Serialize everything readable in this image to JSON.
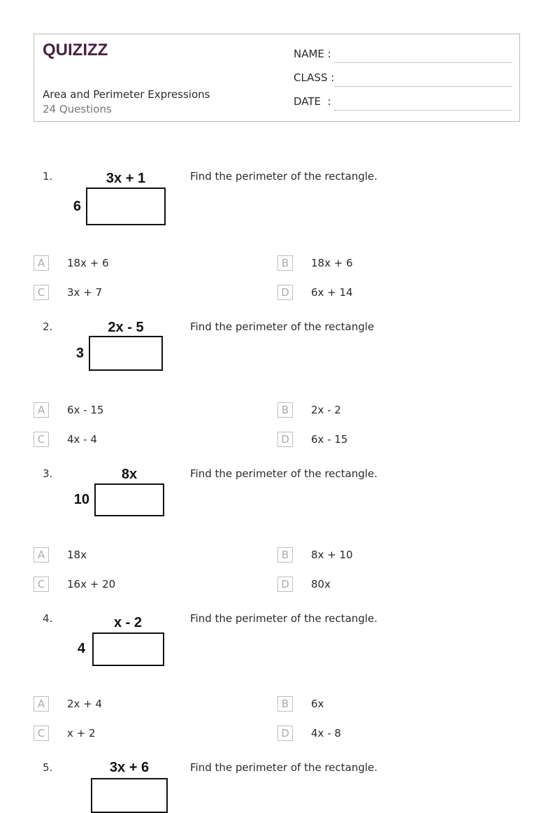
{
  "header": {
    "logo": "QUIZIZZ",
    "title": "Area and Perimeter Expressions",
    "count": "24 Questions",
    "fields": [
      {
        "label": "NAME :"
      },
      {
        "label": "CLASS :"
      },
      {
        "label": "DATE  :"
      }
    ]
  },
  "questions": [
    {
      "number": "1.",
      "text": "Find the perimeter of the rectangle.",
      "figure": {
        "top": "3x + 1",
        "side": "6"
      },
      "options": [
        {
          "letter": "A",
          "text": "18x + 6"
        },
        {
          "letter": "B",
          "text": "18x + 6"
        },
        {
          "letter": "C",
          "text": "3x + 7"
        },
        {
          "letter": "D",
          "text": "6x + 14"
        }
      ]
    },
    {
      "number": "2.",
      "text": "Find the perimeter of the rectangle",
      "figure": {
        "top": "2x - 5",
        "side": "3"
      },
      "options": [
        {
          "letter": "A",
          "text": "6x - 15"
        },
        {
          "letter": "B",
          "text": "2x - 2"
        },
        {
          "letter": "C",
          "text": "4x - 4"
        },
        {
          "letter": "D",
          "text": "6x - 15"
        }
      ]
    },
    {
      "number": "3.",
      "text": "Find the perimeter of the rectangle.",
      "figure": {
        "top": "8x",
        "side": "10"
      },
      "options": [
        {
          "letter": "A",
          "text": "18x"
        },
        {
          "letter": "B",
          "text": "8x + 10"
        },
        {
          "letter": "C",
          "text": "16x + 20"
        },
        {
          "letter": "D",
          "text": "80x"
        }
      ]
    },
    {
      "number": "4.",
      "text": "Find the perimeter of the rectangle.",
      "figure": {
        "top": "x - 2",
        "side": "4"
      },
      "options": [
        {
          "letter": "A",
          "text": "2x + 4"
        },
        {
          "letter": "B",
          "text": "6x"
        },
        {
          "letter": "C",
          "text": "x + 2"
        },
        {
          "letter": "D",
          "text": "4x - 8"
        }
      ]
    },
    {
      "number": "5.",
      "text": "Find the perimeter of the rectangle.",
      "figure": {
        "top": "3x + 6",
        "side": ""
      },
      "options": []
    }
  ]
}
